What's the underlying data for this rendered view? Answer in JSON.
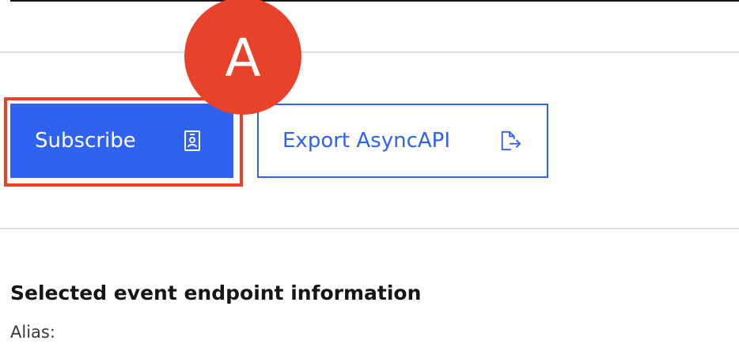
{
  "annotation": {
    "marker_label": "A",
    "color": "#e8422a"
  },
  "actions": {
    "subscribe_label": "Subscribe",
    "subscribe_icon": "badge-icon",
    "export_label": "Export AsyncAPI",
    "export_icon": "export-icon",
    "accent_color": "#2f62f0"
  },
  "endpoint_info": {
    "title": "Selected event endpoint information",
    "alias_label": "Alias:"
  }
}
